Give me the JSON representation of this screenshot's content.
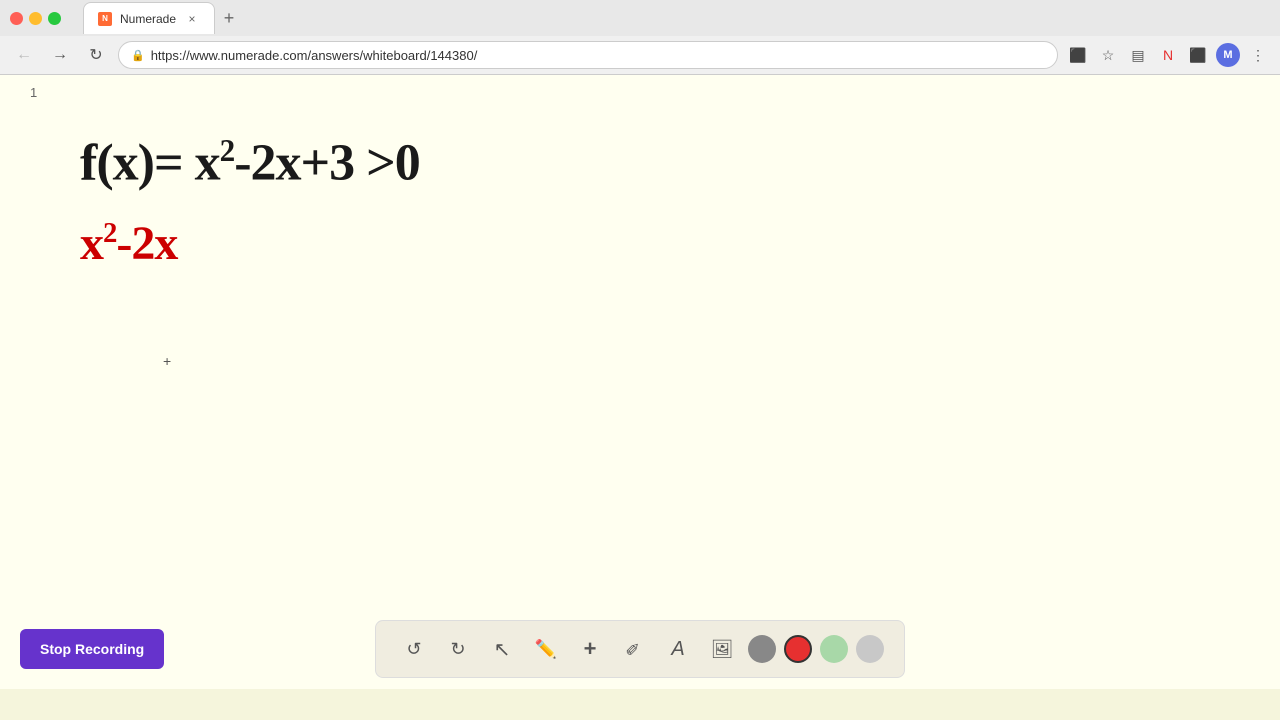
{
  "browser": {
    "tab_title": "Numerade",
    "tab_favicon": "N",
    "url": "https://www.numerade.com/answers/whiteboard/144380/",
    "new_tab_label": "+",
    "close_tab_label": "×"
  },
  "nav": {
    "back_label": "←",
    "forward_label": "→",
    "refresh_label": "↻"
  },
  "toolbar_icons": {
    "video": "📹",
    "bookmark": "☆",
    "extensions": "⬛",
    "more": "⋮"
  },
  "user_avatar": "M",
  "whiteboard": {
    "page_number": "1",
    "equation_black": "f(x)= x²-2x+3 >0",
    "equation_red": "x²-2x",
    "cursor_symbol": "+"
  },
  "bottom_bar": {
    "stop_recording_label": "Stop Recording",
    "undo_label": "↺",
    "redo_label": "↻"
  },
  "tools": {
    "undo": "↺",
    "redo": "↻",
    "select": "▲",
    "pen": "✏",
    "add": "+",
    "highlighter": "/",
    "text": "A",
    "image": "🖼",
    "colors": {
      "gray": "#888888",
      "red": "#e63030",
      "light_green": "#a8d8a8",
      "light_gray": "#c8c8c8"
    }
  }
}
